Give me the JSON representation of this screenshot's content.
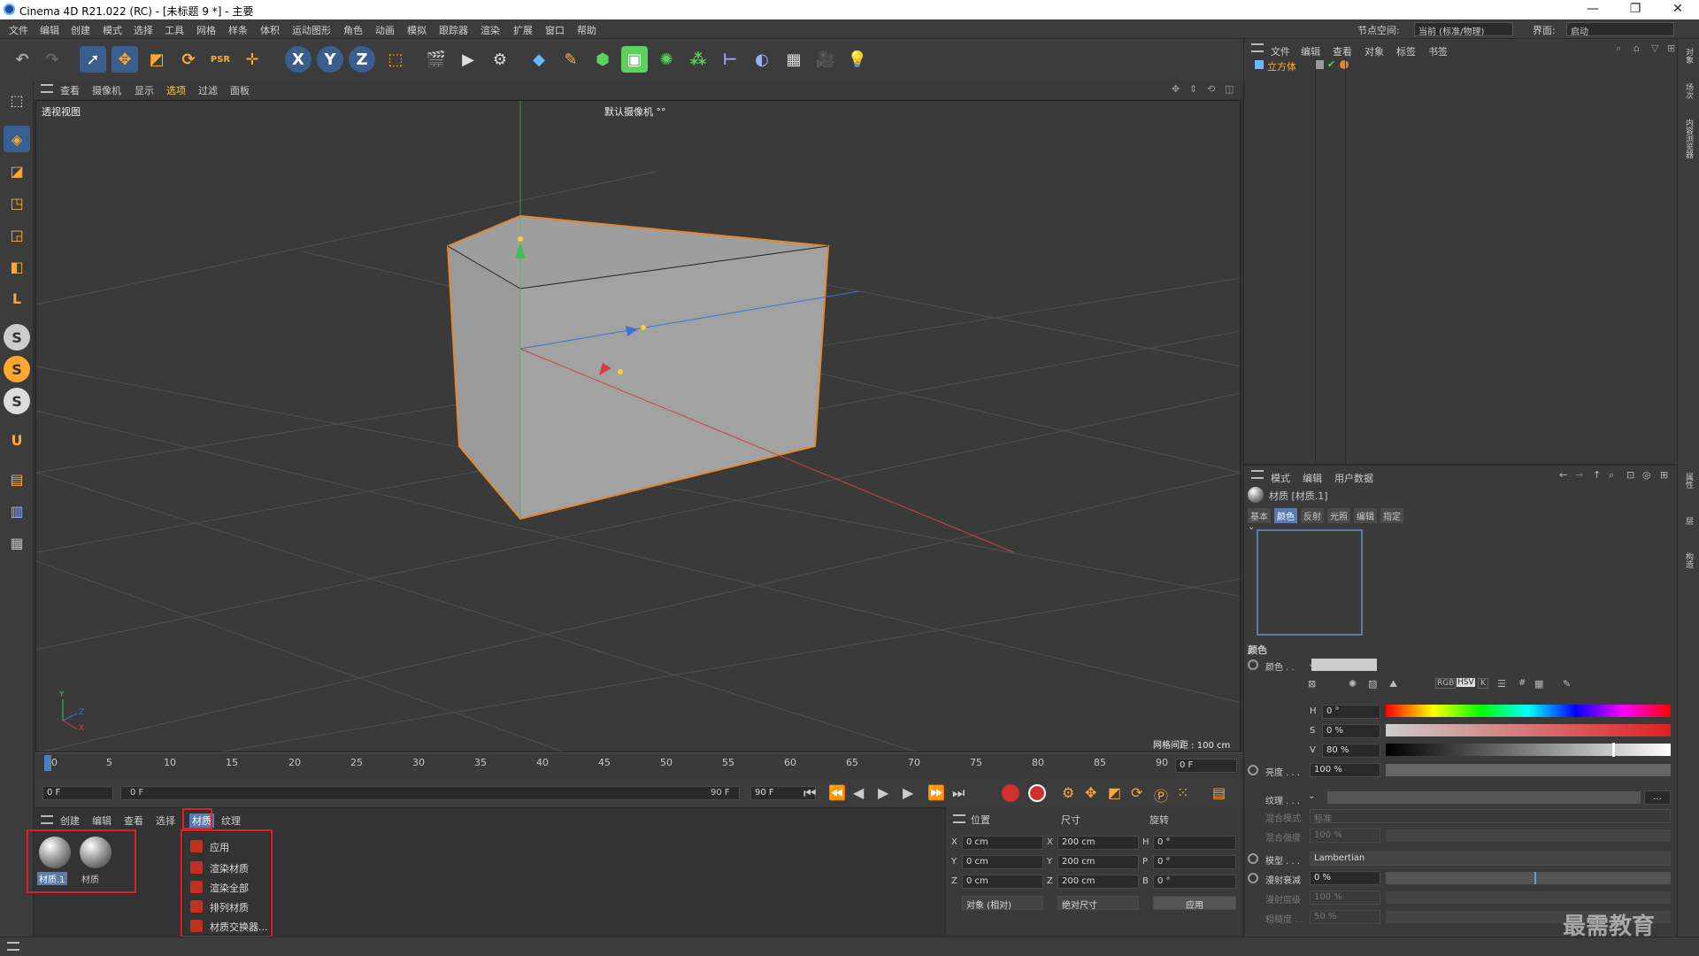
{
  "window": {
    "title": "Cinema 4D R21.022 (RC) - [未标题 9 *] - 主要",
    "min": "—",
    "max": "❐",
    "close": "✕"
  },
  "menu": {
    "items": [
      "文件",
      "编辑",
      "创建",
      "模式",
      "选择",
      "工具",
      "网格",
      "样条",
      "体积",
      "运动图形",
      "角色",
      "动画",
      "模拟",
      "跟踪器",
      "渲染",
      "扩展",
      "窗口",
      "帮助"
    ],
    "node_space_label": "节点空间:",
    "node_space_value": "当前 (标准/物理)",
    "layout_label": "界面:",
    "layout_value": "启动"
  },
  "toolbar": {
    "x_axis": "X",
    "y_axis": "Y",
    "z_axis": "Z",
    "psr_label": "PSR"
  },
  "left_tools": {
    "s1": "S",
    "s2": "S",
    "s3": "S"
  },
  "viewport": {
    "menu": [
      "查看",
      "摄像机",
      "显示",
      "选项",
      "过滤",
      "面板"
    ],
    "view_name": "透视视图",
    "camera_label": "默认摄像机 °°",
    "grid_spacing": "网格间距 : 100 cm",
    "axis_x": "X",
    "axis_y": "Y",
    "axis_z": "Z"
  },
  "timeline": {
    "ticks": [
      "0",
      "5",
      "10",
      "15",
      "20",
      "25",
      "30",
      "35",
      "40",
      "45",
      "50",
      "55",
      "60",
      "65",
      "70",
      "75",
      "80",
      "85",
      "90"
    ],
    "current_frame": "0 F",
    "start_frame": "0 F",
    "range_start": "0 F",
    "range_end": "90 F",
    "end_frame": "90 F"
  },
  "material_manager": {
    "menu": [
      "创建",
      "编辑",
      "查看",
      "选择",
      "材质",
      "纹理"
    ],
    "active_menu": "材质",
    "materials": [
      {
        "name": "材质.1"
      },
      {
        "name": "材质"
      }
    ],
    "context_menu": [
      "应用",
      "渲染材质",
      "渲染全部",
      "排列材质",
      "材质交换器..."
    ]
  },
  "coordinates": {
    "headers": {
      "position": "位置",
      "size": "尺寸",
      "rotation": "旋转"
    },
    "rows": [
      {
        "axis": "X",
        "pos": "0 cm",
        "size_axis": "X",
        "size": "200 cm",
        "rot_axis": "H",
        "rot": "0 °"
      },
      {
        "axis": "Y",
        "pos": "0 cm",
        "size_axis": "Y",
        "size": "200 cm",
        "rot_axis": "P",
        "rot": "0 °"
      },
      {
        "axis": "Z",
        "pos": "0 cm",
        "size_axis": "Z",
        "size": "200 cm",
        "rot_axis": "B",
        "rot": "0 °"
      }
    ],
    "mode": "对象 (相对)",
    "size_mode": "绝对尺寸",
    "apply": "应用"
  },
  "object_manager": {
    "menu": [
      "文件",
      "编辑",
      "查看",
      "对象",
      "标签",
      "书签"
    ],
    "objects": [
      {
        "name": "立方体"
      }
    ]
  },
  "attributes": {
    "menu": [
      "模式",
      "编辑",
      "用户数据"
    ],
    "title": "材质 [材质.1]",
    "tabs": [
      "基本",
      "颜色",
      "反射",
      "光照",
      "编辑",
      "指定"
    ],
    "active_tab": "颜色",
    "section": "颜色",
    "color_label": "颜色 . .",
    "color_modes": [
      "RGB",
      "HSV",
      "K",
      "",
      "#",
      ""
    ],
    "hsv": [
      {
        "label": "H",
        "value": "0 °"
      },
      {
        "label": "S",
        "value": "0 %"
      },
      {
        "label": "V",
        "value": "80 %"
      }
    ],
    "brightness_label": "亮度 . . .",
    "brightness_value": "100 %",
    "texture_label": "纹理 . . .",
    "texture_button": "...",
    "blend_mode_label": "混合模式",
    "blend_mode_value": "标准",
    "blend_strength_label": "混合强度",
    "blend_strength_value": "100 %",
    "model_label": "模型 . . .",
    "model_value": "Lambertian",
    "diffuse_falloff_label": "漫射衰减",
    "diffuse_falloff_value": "0 %",
    "diffuse_level_label": "漫射层级",
    "diffuse_level_value": "100 %",
    "roughness_label": "粗糙度 . .",
    "roughness_value": "50 %"
  },
  "right_strip": {
    "tab1": "对象",
    "tab2": "场次",
    "tab3": "内容浏览器",
    "tab4": "属性",
    "tab5": "层",
    "tab6": "构造"
  },
  "watermark": "最需教育",
  "colors": {
    "accent_red": "#e02020",
    "cube_outline": "#e08a30",
    "grid": "#555555"
  }
}
